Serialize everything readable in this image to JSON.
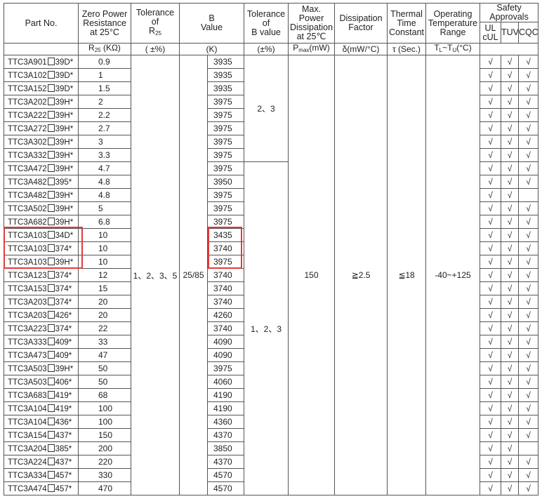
{
  "headers": {
    "part_no": "Part No.",
    "zero_power": {
      "l1": "Zero Power",
      "l2": "Resistance",
      "l3": "at 25°C",
      "unit_pre": "R",
      "unit_sub": "25",
      "unit_post": " (KΩ)"
    },
    "tol_r": {
      "l1": "Tolerance",
      "l2": "of",
      "l3_pre": "R",
      "l3_sub": "25",
      "unit": "( ±%)"
    },
    "b_value": {
      "l1": "B",
      "l2": "Value",
      "unit": "(K)"
    },
    "tol_b": {
      "l1": "Tolerance",
      "l2": "of",
      "l3": "B value",
      "unit": "(±%)"
    },
    "max_power": {
      "l1": "Max. Power",
      "l2": "Dissipation",
      "l3": "at 25℃",
      "unit_pre": "P",
      "unit_sub": "max",
      "unit_post": "(mW)"
    },
    "dissipation": {
      "l1": "Dissipation",
      "l2": "Factor",
      "unit": "δ(mW/°C)"
    },
    "thermal": {
      "l1": "Thermal",
      "l2": "Time",
      "l3": "Constant",
      "unit": "τ (Sec.)"
    },
    "operating": {
      "l1": "Operating",
      "l2": "Temperature",
      "l3": "Range",
      "unit_a": "T",
      "unit_a_sub": "L",
      "unit_mid": "~T",
      "unit_b_sub": "U",
      "unit_post": "(°C)"
    },
    "safety": {
      "title": "Safety Approvals",
      "ul_l1": "UL",
      "ul_l2": "cUL",
      "tuv": "TUV",
      "cqc": "CQC"
    }
  },
  "spans": {
    "tol_r": "1、2、3、5",
    "b_ratio": "25/85",
    "tol_b_top": "2、3",
    "tol_b_bottom": "1、2、3",
    "max_power": "150",
    "dissipation": "≧2.5",
    "thermal": "≦18",
    "operating": "-40~+125"
  },
  "check_symbol": "√",
  "rows": [
    {
      "pre": "TTC3A901",
      "post": "39D*",
      "r": "0.9",
      "b": "3935",
      "ul": true,
      "tuv": true,
      "cqc": true
    },
    {
      "pre": "TTC3A102",
      "post": "39D*",
      "r": "1",
      "b": "3935",
      "ul": true,
      "tuv": true,
      "cqc": true
    },
    {
      "pre": "TTC3A152",
      "post": "39D*",
      "r": "1.5",
      "b": "3935",
      "ul": true,
      "tuv": true,
      "cqc": true
    },
    {
      "pre": "TTC3A202",
      "post": "39H*",
      "r": "2",
      "b": "3975",
      "ul": true,
      "tuv": true,
      "cqc": true
    },
    {
      "pre": "TTC3A222",
      "post": "39H*",
      "r": "2.2",
      "b": "3975",
      "ul": true,
      "tuv": true,
      "cqc": true
    },
    {
      "pre": "TTC3A272",
      "post": "39H*",
      "r": "2.7",
      "b": "3975",
      "ul": true,
      "tuv": true,
      "cqc": true
    },
    {
      "pre": "TTC3A302",
      "post": "39H*",
      "r": "3",
      "b": "3975",
      "ul": true,
      "tuv": true,
      "cqc": true
    },
    {
      "pre": "TTC3A332",
      "post": "39H*",
      "r": "3.3",
      "b": "3975",
      "ul": true,
      "tuv": true,
      "cqc": true
    },
    {
      "pre": "TTC3A472",
      "post": "39H*",
      "r": "4.7",
      "b": "3975",
      "ul": true,
      "tuv": true,
      "cqc": true
    },
    {
      "pre": "TTC3A482",
      "post": "395*",
      "r": "4.8",
      "b": "3950",
      "ul": true,
      "tuv": true,
      "cqc": true
    },
    {
      "pre": "TTC3A482",
      "post": "39H*",
      "r": "4.8",
      "b": "3975",
      "ul": true,
      "tuv": true,
      "cqc": false
    },
    {
      "pre": "TTC3A502",
      "post": "39H*",
      "r": "5",
      "b": "3975",
      "ul": true,
      "tuv": true,
      "cqc": true
    },
    {
      "pre": "TTC3A682",
      "post": "39H*",
      "r": "6.8",
      "b": "3975",
      "ul": true,
      "tuv": true,
      "cqc": true
    },
    {
      "pre": "TTC3A103",
      "post": "34D*",
      "r": "10",
      "b": "3435",
      "ul": true,
      "tuv": true,
      "cqc": true
    },
    {
      "pre": "TTC3A103",
      "post": "374*",
      "r": "10",
      "b": "3740",
      "ul": true,
      "tuv": true,
      "cqc": true
    },
    {
      "pre": "TTC3A103",
      "post": "39H*",
      "r": "10",
      "b": "3975",
      "ul": true,
      "tuv": true,
      "cqc": true
    },
    {
      "pre": "TTC3A123",
      "post": "374*",
      "r": "12",
      "b": "3740",
      "ul": true,
      "tuv": true,
      "cqc": true
    },
    {
      "pre": "TTC3A153",
      "post": "374*",
      "r": "15",
      "b": "3740",
      "ul": true,
      "tuv": true,
      "cqc": true
    },
    {
      "pre": "TTC3A203",
      "post": "374*",
      "r": "20",
      "b": "3740",
      "ul": true,
      "tuv": true,
      "cqc": true
    },
    {
      "pre": "TTC3A203",
      "post": "426*",
      "r": "20",
      "b": "4260",
      "ul": true,
      "tuv": true,
      "cqc": true
    },
    {
      "pre": "TTC3A223",
      "post": "374*",
      "r": "22",
      "b": "3740",
      "ul": true,
      "tuv": true,
      "cqc": true
    },
    {
      "pre": "TTC3A333",
      "post": "409*",
      "r": "33",
      "b": "4090",
      "ul": true,
      "tuv": true,
      "cqc": true
    },
    {
      "pre": "TTC3A473",
      "post": "409*",
      "r": "47",
      "b": "4090",
      "ul": true,
      "tuv": true,
      "cqc": true
    },
    {
      "pre": "TTC3A503",
      "post": "39H*",
      "r": "50",
      "b": "3975",
      "ul": true,
      "tuv": true,
      "cqc": true
    },
    {
      "pre": "TTC3A503",
      "post": "406*",
      "r": "50",
      "b": "4060",
      "ul": true,
      "tuv": true,
      "cqc": true
    },
    {
      "pre": "TTC3A683",
      "post": "419*",
      "r": "68",
      "b": "4190",
      "ul": true,
      "tuv": true,
      "cqc": true
    },
    {
      "pre": "TTC3A104",
      "post": "419*",
      "r": "100",
      "b": "4190",
      "ul": true,
      "tuv": true,
      "cqc": true
    },
    {
      "pre": "TTC3A104",
      "post": "436*",
      "r": "100",
      "b": "4360",
      "ul": true,
      "tuv": true,
      "cqc": true
    },
    {
      "pre": "TTC3A154",
      "post": "437*",
      "r": "150",
      "b": "4370",
      "ul": true,
      "tuv": true,
      "cqc": true
    },
    {
      "pre": "TTC3A204",
      "post": "385*",
      "r": "200",
      "b": "3850",
      "ul": true,
      "tuv": true,
      "cqc": false
    },
    {
      "pre": "TTC3A224",
      "post": "437*",
      "r": "220",
      "b": "4370",
      "ul": true,
      "tuv": true,
      "cqc": true
    },
    {
      "pre": "TTC3A334",
      "post": "457*",
      "r": "330",
      "b": "4570",
      "ul": true,
      "tuv": true,
      "cqc": true
    },
    {
      "pre": "TTC3A474",
      "post": "457*",
      "r": "470",
      "b": "4570",
      "ul": true,
      "tuv": true,
      "cqc": true
    }
  ],
  "highlight_color": "#e03c3c"
}
